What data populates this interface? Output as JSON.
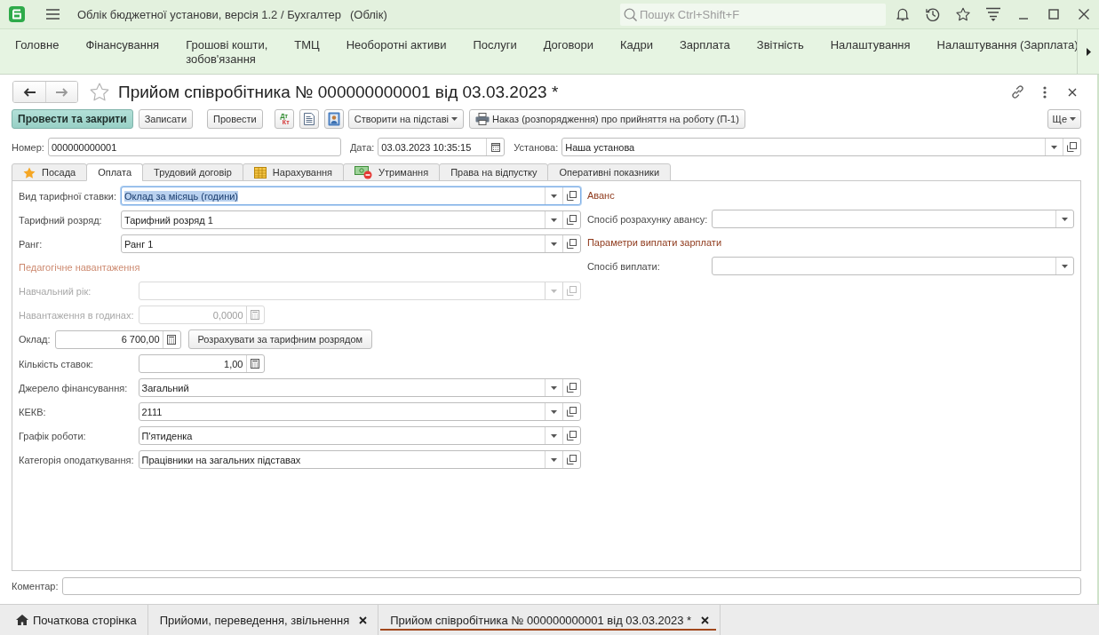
{
  "window": {
    "title": "Облік бюджетної установи, версія 1.2 / Бухгалтер",
    "mode": "(Облік)"
  },
  "search": {
    "placeholder": "Пошук Ctrl+Shift+F"
  },
  "sections": [
    "Головне",
    "Фінансування",
    "Грошові кошти,\nзобов'язання",
    "ТМЦ",
    "Необоротні активи",
    "Послуги",
    "Договори",
    "Кадри",
    "Зарплата",
    "Звітність",
    "Налаштування",
    "Налаштування (Зарплата)"
  ],
  "document": {
    "title": "Прийом співробітника № 000000000001 від 03.03.2023 *",
    "favorite": false
  },
  "toolbar": {
    "actions": [
      {
        "label": "Провести та закрити",
        "primary": true
      },
      {
        "label": "Записати",
        "primary": false
      },
      {
        "label": "Провести",
        "primary": false
      }
    ],
    "entries": {
      "debit": "Дт",
      "credit": "Кт"
    },
    "create_based_on": "Створити на підставі",
    "print": "Наказ (розпорядження) про прийняття на роботу (П-1)",
    "more": "Ще"
  },
  "header": {
    "number": {
      "label": "Номер:",
      "value": "000000000001"
    },
    "date": {
      "label": "Дата:",
      "value": "03.03.2023 10:35:15"
    },
    "institution": {
      "label": "Установа:",
      "value": "Наша установа"
    }
  },
  "tabs": [
    {
      "label": "Посада",
      "selected": false
    },
    {
      "label": "Оплата",
      "selected": true
    },
    {
      "label": "Трудовий договір",
      "selected": false
    },
    {
      "label": "Нарахування",
      "selected": false
    },
    {
      "label": "Утримання",
      "selected": false
    },
    {
      "label": "Права на відпустку",
      "selected": false
    },
    {
      "label": "Оперативні показники",
      "selected": false
    }
  ],
  "payment": {
    "left": [
      {
        "items": [
          {
            "kind": "ref",
            "label": "Вид тарифної ставки:",
            "value": "Оклад за місяць (години)",
            "disabled": false,
            "focused": true
          },
          {
            "kind": "ref",
            "label": "Тарифний розряд:",
            "value": "Тарифний розряд 1",
            "disabled": false,
            "focused": false
          },
          {
            "kind": "ref",
            "label": "Ранг:",
            "value": "Ранг 1",
            "disabled": false,
            "focused": false
          }
        ]
      },
      {
        "items": [
          {
            "kind": "heading",
            "text": "Педагогічне навантаження",
            "disabled": true
          },
          {
            "kind": "ref",
            "label": "Навчальний рік:",
            "disabled": true,
            "focused": false
          },
          {
            "kind": "number",
            "label": "Навантаження в годинах:",
            "value": "0,0000",
            "disabled": true,
            "focused": false
          }
        ]
      },
      {
        "items": [
          {
            "kind": "number",
            "label": "Оклад:",
            "value": "6 700,00",
            "action": "Розрахувати за тарифним розрядом",
            "disabled": false,
            "focused": false
          }
        ]
      },
      {
        "items": [
          {
            "kind": "number",
            "label": "Кількість ставок:",
            "value": "1,00",
            "disabled": false,
            "focused": false
          },
          {
            "kind": "ref",
            "label": "Джерело фінансування:",
            "value": "Загальний",
            "disabled": false,
            "focused": false
          },
          {
            "kind": "ref",
            "label": "КЕКВ:",
            "value": "2111",
            "disabled": false,
            "focused": false
          },
          {
            "kind": "ref",
            "label": "Графік роботи:",
            "value": "П'ятиденка",
            "disabled": false,
            "focused": false
          },
          {
            "kind": "ref",
            "label": "Категорія оподаткування:",
            "value": "Працівники на загальних підставах",
            "disabled": false,
            "focused": false
          }
        ]
      }
    ],
    "right": [
      {
        "items": [
          {
            "kind": "heading",
            "text": "Аванс",
            "disabled": false
          },
          {
            "kind": "list",
            "label": "Спосіб розрахунку авансу:",
            "disabled": false,
            "focused": false
          },
          {
            "kind": "heading",
            "text": "Параметри виплати зарплати",
            "disabled": false
          },
          {
            "kind": "list",
            "label": "Спосіб виплати:",
            "disabled": false,
            "focused": false
          }
        ]
      }
    ]
  },
  "comment": {
    "label": "Коментар:"
  },
  "open_windows": [
    {
      "kind": "home",
      "label": "Початкова сторінка",
      "selected": false
    },
    {
      "kind": "window",
      "label": "Прийоми, переведення, звільнення",
      "selected": false
    },
    {
      "kind": "window",
      "label": "Прийом співробітника № 000000000001 від 03.03.2023 *",
      "selected": true
    }
  ]
}
